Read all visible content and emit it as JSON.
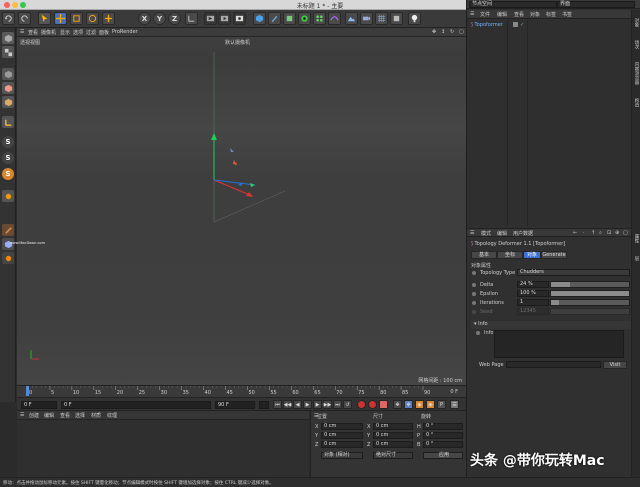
{
  "window": {
    "title": "未标题 1 * - 主要"
  },
  "toolbar": {
    "axis_x": "X",
    "axis_y": "Y",
    "axis_z": "Z",
    "icons": [
      "undo-icon",
      "redo-icon",
      "select-icon",
      "move-icon",
      "scale-icon",
      "rotate-icon",
      "axis-x",
      "axis-y",
      "axis-z",
      "coord-icon",
      "render-view-icon",
      "render-icon",
      "render-settings-icon",
      "cube-icon",
      "pen-icon",
      "subdivide-icon",
      "cloner-icon",
      "deformer-icon",
      "environment-icon",
      "camera-icon",
      "light-icon"
    ]
  },
  "viewport": {
    "menu": [
      "查看",
      "摄像机",
      "显示",
      "选项",
      "过滤",
      "面板",
      "ProRender"
    ],
    "name": "透视视图",
    "camera": "默认摄像机",
    "grid_spacing": "网格间距 : 100 cm"
  },
  "timeline": {
    "ticks": [
      "0",
      "5",
      "10",
      "15",
      "20",
      "25",
      "30",
      "35",
      "40",
      "45",
      "50",
      "55",
      "60",
      "65",
      "70",
      "75",
      "80",
      "85",
      "90"
    ],
    "current_frame": "0 F"
  },
  "transport": {
    "start": "0 F",
    "current": "0 F",
    "end1": "90 F",
    "end2": "90 F"
  },
  "material_manager": {
    "menu": [
      "创建",
      "编辑",
      "查看",
      "选择",
      "材质",
      "纹理"
    ]
  },
  "coordinates": {
    "headers": [
      "位置",
      "尺寸",
      "旋转"
    ],
    "rows": [
      {
        "axis": "X",
        "pos": "0 cm",
        "axis2": "X",
        "size": "0 cm",
        "rot_axis": "H",
        "rot": "0 °"
      },
      {
        "axis": "Y",
        "pos": "0 cm",
        "axis2": "Y",
        "size": "0 cm",
        "rot_axis": "P",
        "rot": "0 °"
      },
      {
        "axis": "Z",
        "pos": "0 cm",
        "axis2": "Z",
        "size": "0 cm",
        "rot_axis": "B",
        "rot": "0 °"
      }
    ],
    "mode1": "对象 (相对)",
    "mode2": "绝对尺寸",
    "apply": "应用"
  },
  "right_panel": {
    "dropdown1": "节点空间",
    "dropdown2": "界面",
    "om_menu": [
      "文件",
      "编辑",
      "查看",
      "对象",
      "标签",
      "书签"
    ],
    "object_name": "Topoformer",
    "side_tabs_top": [
      "对象",
      "场次",
      "内容浏览器",
      "构造"
    ],
    "side_tabs_bottom": [
      "属性",
      "层"
    ],
    "attr_menu": [
      "模式",
      "编辑",
      "用户数据"
    ],
    "attr_title": "Topology Deformer 1.1 [Topoformer]",
    "attr_tabs": [
      "基本",
      "坐标",
      "对象",
      "Generate"
    ],
    "section": "对象属性",
    "topology_type_label": "Topology Type",
    "topology_type_value": "Chudders",
    "params": [
      {
        "label": "Delta",
        "value": "24 %",
        "fill": 0.24
      },
      {
        "label": "Epsilon",
        "value": "100 %",
        "fill": 1.0
      },
      {
        "label": "Iterations",
        "value": "1",
        "fill": 0.1
      },
      {
        "label": "Seed",
        "value": "12345",
        "fill": 0
      }
    ],
    "info_section": "Info",
    "info_label": "Info",
    "webpage_label": "Web Page",
    "visit_button": "Visit"
  },
  "status": {
    "text": "移动：点击并拖动鼠标移动元素。按住 SHIFT 键量化移动；节点编辑模式时按住 SHIFT 键增加选择对象；按住 CTRL 键减少选择对象。"
  },
  "watermark": "头条 @带你玩转Mac",
  "site_watermark": "www.MacDown.com",
  "colors": {
    "accent": "#3b6fd1",
    "x_axis": "#d33",
    "y_axis": "#2c2",
    "z_axis": "#36c"
  }
}
